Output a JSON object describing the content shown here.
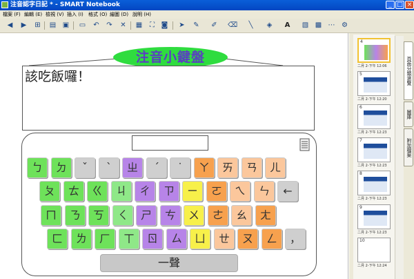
{
  "window": {
    "title": "注音認字日記 * - SMART Notebook",
    "buttons": {
      "minimize": "_",
      "maximize": "□",
      "close": "×"
    }
  },
  "menu": {
    "items": [
      "檔案 (F)",
      "編輯 (E)",
      "檢視 (V)",
      "插入 (I)",
      "格式 (O)",
      "繪圖 (D)",
      "說明 (H)"
    ]
  },
  "toolbar": {
    "icons": [
      "previous-page-icon",
      "next-page-icon",
      "add-page-icon",
      "open-icon",
      "save-icon",
      "paste-icon",
      "undo-icon",
      "redo-icon",
      "delete-icon",
      "screen-shade-icon",
      "full-screen-icon",
      "capture-icon",
      "select-icon",
      "pen-icon",
      "creative-pen-icon",
      "eraser-icon",
      "line-icon",
      "fill-icon",
      "text-icon",
      "properties-icon",
      "table-icon",
      "more-icon"
    ]
  },
  "canvas": {
    "title_label": "注音小鍵盤",
    "written_text": "該吃飯囉！",
    "keyboard": {
      "rows": [
        [
          {
            "t": "ㄅ",
            "c": "#6ee25a"
          },
          {
            "t": "ㄉ",
            "c": "#6ee25a"
          },
          {
            "t": "ˇ",
            "c": "#cfcfcf"
          },
          {
            "t": "ˋ",
            "c": "#cfcfcf"
          },
          {
            "t": "ㄓ",
            "c": "#b784e8"
          },
          {
            "t": "ˊ",
            "c": "#cfcfcf"
          },
          {
            "t": "˙",
            "c": "#cfcfcf"
          },
          {
            "t": "ㄚ",
            "c": "#f7a14e"
          },
          {
            "t": "ㄞ",
            "c": "#fbc79c"
          },
          {
            "t": "ㄢ",
            "c": "#fbc79c"
          },
          {
            "t": "ㄦ",
            "c": "#fbc79c"
          }
        ],
        [
          {
            "t": "ㄆ",
            "c": "#6ee25a"
          },
          {
            "t": "ㄊ",
            "c": "#6ee25a"
          },
          {
            "t": "ㄍ",
            "c": "#6ee25a"
          },
          {
            "t": "ㄐ",
            "c": "#8fe888"
          },
          {
            "t": "ㄔ",
            "c": "#b784e8"
          },
          {
            "t": "ㄗ",
            "c": "#b784e8"
          },
          {
            "t": "ㄧ",
            "c": "#f7f04a"
          },
          {
            "t": "ㄛ",
            "c": "#f7a14e"
          },
          {
            "t": "ㄟ",
            "c": "#fbc79c"
          },
          {
            "t": "ㄣ",
            "c": "#fbc79c"
          },
          {
            "t": "←",
            "c": "#cfcfcf"
          }
        ],
        [
          {
            "t": "ㄇ",
            "c": "#6ee25a"
          },
          {
            "t": "ㄋ",
            "c": "#6ee25a"
          },
          {
            "t": "ㄎ",
            "c": "#6ee25a"
          },
          {
            "t": "ㄑ",
            "c": "#8fe888"
          },
          {
            "t": "ㄕ",
            "c": "#b784e8"
          },
          {
            "t": "ㄘ",
            "c": "#b784e8"
          },
          {
            "t": "ㄨ",
            "c": "#f7f04a"
          },
          {
            "t": "ㄜ",
            "c": "#f7a14e"
          },
          {
            "t": "ㄠ",
            "c": "#fbc79c"
          },
          {
            "t": "ㄤ",
            "c": "#f7a14e"
          }
        ],
        [
          {
            "t": "ㄈ",
            "c": "#6ee25a"
          },
          {
            "t": "ㄌ",
            "c": "#6ee25a"
          },
          {
            "t": "ㄏ",
            "c": "#6ee25a"
          },
          {
            "t": "ㄒ",
            "c": "#8fe888"
          },
          {
            "t": "ㄖ",
            "c": "#b784e8"
          },
          {
            "t": "ㄙ",
            "c": "#b784e8"
          },
          {
            "t": "ㄩ",
            "c": "#f7f04a"
          },
          {
            "t": "ㄝ",
            "c": "#fbc79c"
          },
          {
            "t": "ㄡ",
            "c": "#f7a14e"
          },
          {
            "t": "ㄥ",
            "c": "#f7a14e"
          },
          {
            "t": "，",
            "c": "#cfcfcf"
          }
        ]
      ],
      "space_label": "一聲"
    }
  },
  "page_sorter": {
    "pages": [
      {
        "num": "4",
        "date": "二月 2-下午 12:06"
      },
      {
        "num": "5",
        "date": "二月 2-下午 12:20"
      },
      {
        "num": "6",
        "date": "二月 2-下午 12:23"
      },
      {
        "num": "7",
        "date": "二月 2-下午 12:23"
      },
      {
        "num": "8",
        "date": "二月 2-下午 12:23"
      },
      {
        "num": "9",
        "date": "二月 2-下午 12:23"
      },
      {
        "num": "10",
        "date": "二月 2-下午 12:24"
      }
    ]
  },
  "side_tabs": [
    "頁面分類瀏覽",
    "圖庫",
    "附加檔案"
  ],
  "colors": {
    "title_bar": "#0a5fd8",
    "green_ellipse": "#2fdc3f",
    "purple_text": "#5a3ec2"
  }
}
